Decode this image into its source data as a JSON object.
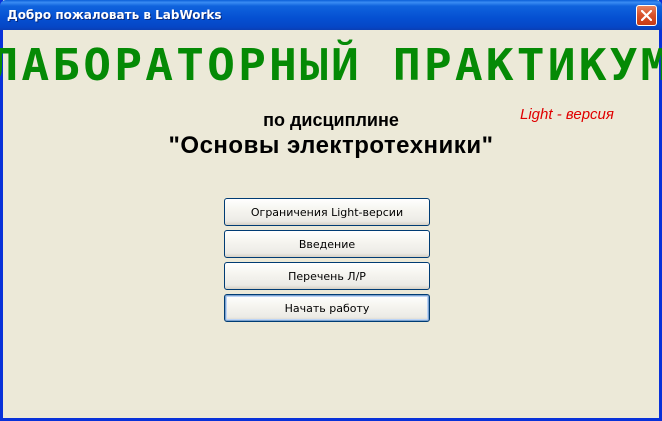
{
  "window": {
    "title": "Добро пожаловать в LabWorks"
  },
  "main": {
    "heading": "ЛАБОРАТОРНЫЙ ПРАКТИКУМ",
    "light_label": "Light - версия",
    "subtitle": "по дисциплине",
    "discipline": "\"Основы электротехники\""
  },
  "buttons": [
    {
      "label": "Ограничения Light-версии"
    },
    {
      "label": "Введение"
    },
    {
      "label": "Перечень Л/Р"
    },
    {
      "label": "Начать работу"
    }
  ],
  "colors": {
    "heading": "#058a05",
    "light_label": "#e00000",
    "titlebar": "#0550d2",
    "background": "#ece9d8"
  },
  "icons": {
    "close": "close-icon"
  }
}
